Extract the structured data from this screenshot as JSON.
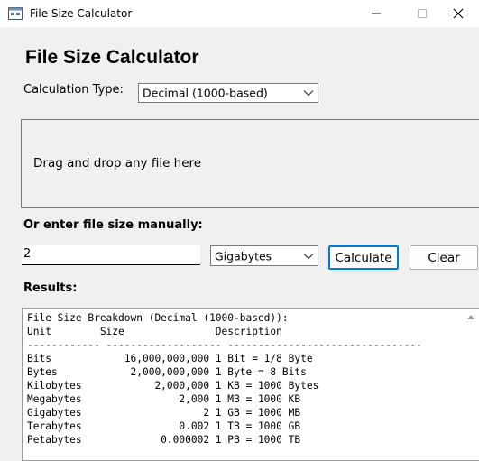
{
  "window": {
    "title": "File Size Calculator",
    "controls": {
      "minimize": "–",
      "maximize": "☐",
      "close": "✕"
    }
  },
  "heading": "File Size Calculator",
  "calc_type": {
    "label": "Calculation Type:",
    "selected": "Decimal (1000-based)"
  },
  "dropzone": {
    "text": "Drag and drop any file here"
  },
  "manual": {
    "label": "Or enter file size manually:",
    "value": "2",
    "unit_selected": "Gigabytes",
    "calculate_label": "Calculate",
    "clear_label": "Clear"
  },
  "results": {
    "label": "Results:",
    "text": "File Size Breakdown (Decimal (1000-based)):\nUnit        Size               Description\n------------ ------------------- --------------------------------\nBits            16,000,000,000 1 Bit = 1/8 Byte\nBytes            2,000,000,000 1 Byte = 8 Bits\nKilobytes            2,000,000 1 KB = 1000 Bytes\nMegabytes                2,000 1 MB = 1000 KB\nGigabytes                    2 1 GB = 1000 MB\nTerabytes                0.002 1 TB = 1000 GB\nPetabytes             0.000002 1 PB = 1000 TB"
  },
  "colors": {
    "accent": "#0078d7",
    "background": "#f0f0f0"
  }
}
